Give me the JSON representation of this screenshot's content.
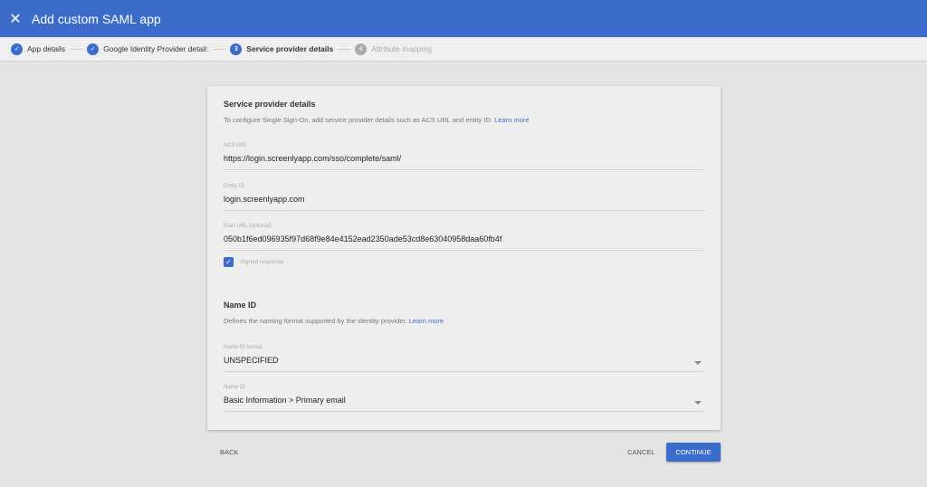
{
  "header": {
    "title": "Add custom SAML app"
  },
  "steps": [
    {
      "label": "App details",
      "num": "1"
    },
    {
      "label": "Google Identity Provider detail:",
      "num": "2"
    },
    {
      "label": "Service provider details",
      "num": "3"
    },
    {
      "label": "Attribute mapping",
      "num": "4"
    }
  ],
  "sp": {
    "title": "Service provider details",
    "desc": "To configure Single Sign-On, add service provider details such as ACS URL and entity ID.",
    "learn": "Learn more",
    "acs_label": "ACS URL",
    "acs": "https://login.screenlyapp.com/sso/complete/saml/",
    "entity_label": "Entity ID",
    "entity": "login.screenlyapp.com",
    "start_label": "Start URL (optional)",
    "start": "050b1f6ed096935f97d68f9e84e4152ead2350ade53cd8e63040958daa60fb4f",
    "signed": "Signed response",
    "signed_checked": true
  },
  "nameid": {
    "title": "Name ID",
    "desc": "Defines the naming format supported by the identity provider.",
    "learn": "Learn more",
    "format_label": "Name ID format",
    "format": "UNSPECIFIED",
    "id_label": "Name ID",
    "id": "Basic Information > Primary email"
  },
  "buttons": {
    "back": "BACK",
    "cancel": "CANCEL",
    "continue": "CONTINUE"
  }
}
